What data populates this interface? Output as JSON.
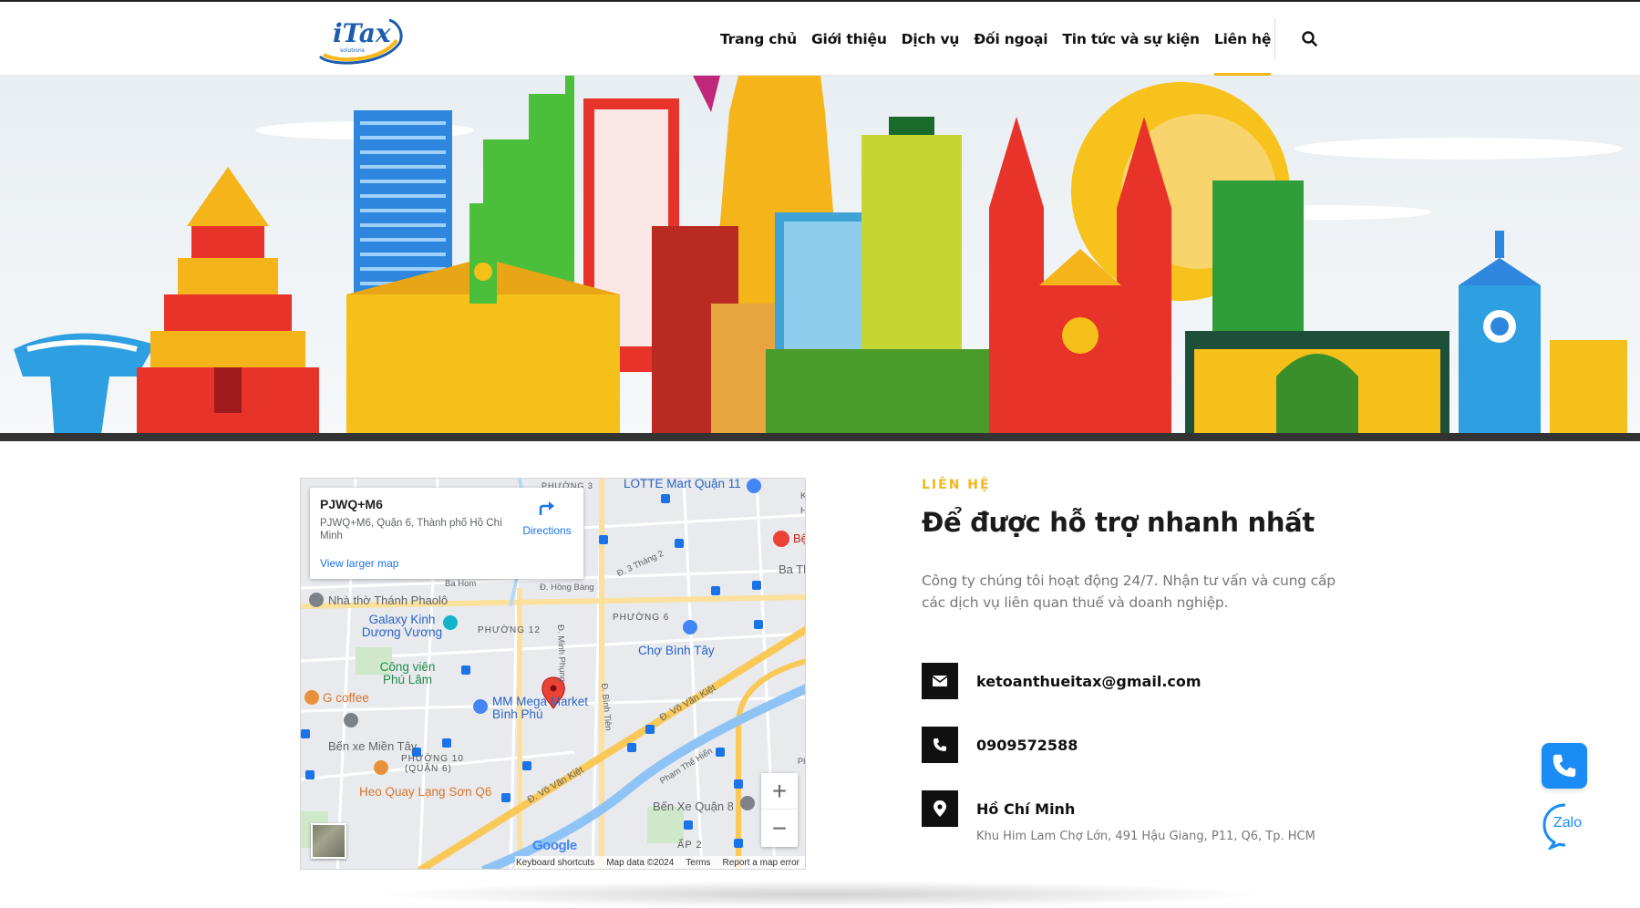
{
  "header": {
    "logo_text": "iTax",
    "logo_subtext": "solutions",
    "nav": [
      {
        "label": "Trang chủ"
      },
      {
        "label": "Giới thiệu"
      },
      {
        "label": "Dịch vụ"
      },
      {
        "label": "Đối ngoại"
      },
      {
        "label": "Tin tức và sự kiện"
      },
      {
        "label": "Liên hệ",
        "active": true
      }
    ],
    "search_icon": "search-icon"
  },
  "map": {
    "card": {
      "title": "PJWQ+M6",
      "address": "PJWQ+M6, Quận 6, Thành phố Hồ Chí Minh",
      "directions": "Directions",
      "larger_map": "View larger map"
    },
    "labels": {
      "lotte": "LOTTE Mart Quận 11",
      "nha_tho": "Nhà thờ Thánh Phaolô",
      "galaxy": "Galaxy Kinh Dương Vương",
      "cong_vien": "Công viên Phú Lâm",
      "gcoffee": "G coffee",
      "mm_mega": "MM Mega Market Bình Phú",
      "ben_xe_mien_tay": "Bến xe Miền Tây",
      "heo_quay": "Heo Quay Lạng Sơn Q6",
      "ben_xe_q8": "Bến Xe Quận 8",
      "cho_binh_tay": "Chợ Bình Tây",
      "phuong_12": "PHƯỜNG 12",
      "phuong_6": "PHƯỜNG 6",
      "phuong_10": "PHƯỜNG 10",
      "quan_6": "(QUẬN 6)",
      "ap_2": "ẤP 2",
      "phuong_3": "PHƯỜNG 3",
      "ba_hom": "Ba Hom",
      "hong_bang": "Đ. Hồng Bàng",
      "street_3thang2": "Đ. 3 Tháng 2",
      "minh_phung": "Đ. Minh Phụng",
      "binh_tien": "Đ. Bình Tiên",
      "vo_van_kiet_1": "Đ. Võ Văn Kiệt",
      "vo_van_kiet_2": "Đ. Võ Văn Kiệt",
      "pham_the_hien": "Phạm Thế Hiển",
      "benh_vien": "Bệ",
      "ba_ti": "Ba Tl",
      "edge_k": "K",
      "edge_h": "H",
      "edge_ph": "PH"
    },
    "zoom_in": "+",
    "zoom_out": "−",
    "google": "Google",
    "footer": {
      "shortcuts": "Keyboard shortcuts",
      "data": "Map data ©2024",
      "terms": "Terms",
      "report": "Report a map error"
    },
    "colors": {
      "pin": "#ea4335",
      "water": "#8ec3f5",
      "highway": "#f9c857"
    }
  },
  "contact": {
    "eyebrow": "LIÊN HỆ",
    "title": "Để được hỗ trợ nhanh nhất",
    "description": "Công ty chúng tôi hoạt động 24/7. Nhận tư vấn và cung cấp các dịch vụ liên quan thuế và doanh nghiệp.",
    "email": "ketoanthueitax@gmail.com",
    "phone": "0909572588",
    "location": "Hồ Chí Minh",
    "address": "Khu Him Lam Chợ Lớn, 491 Hậu Giang, P11, Q6, Tp. HCM"
  },
  "floating": {
    "phone_icon": "phone-icon",
    "zalo": "Zalo"
  },
  "colors": {
    "accent": "#f7b718",
    "phone_fab": "#1b8cf5"
  }
}
